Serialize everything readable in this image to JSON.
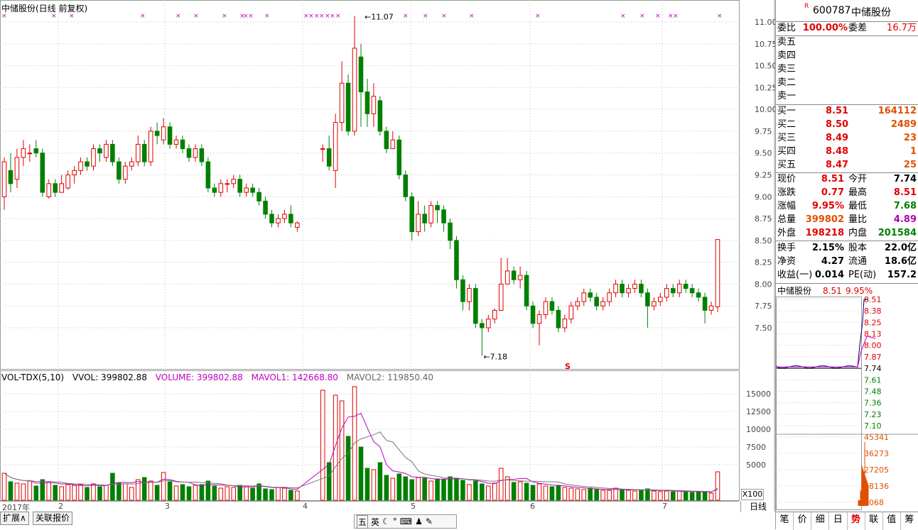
{
  "main_title": "中储股份(日线 前复权)",
  "high_annot": "11.07",
  "low_annot": "7.18",
  "s_mark": "S",
  "vol_legend": {
    "label": "VOL-TDX(5,10)",
    "vvol": "VVOL: 399802.88",
    "volume": "VOLUME: 399802.88",
    "mavol1": "MAVOL1: 142668.80",
    "mavol2": "MAVOL2: 119850.40"
  },
  "price_axis": [
    "11.00",
    "10.75",
    "10.50",
    "10.25",
    "10.00",
    "9.75",
    "9.50",
    "9.25",
    "9.00",
    "8.75",
    "8.50",
    "8.25",
    "8.00",
    "7.75",
    "7.50"
  ],
  "vol_axis": [
    "15000",
    "12500",
    "10000",
    "7500",
    "5000"
  ],
  "x100": "X100",
  "month_labels": [
    "2017年",
    "2",
    "3",
    "4",
    "5",
    "6",
    "7"
  ],
  "day_button": "日线",
  "bottom_tabs": [
    "扩展∧",
    "关联报价"
  ],
  "ime": [
    "五",
    "英",
    "☾",
    "°",
    "⌨",
    "♟",
    "✎"
  ],
  "colors": {
    "up": "#e00000",
    "down": "#008000",
    "grid": "#c0c0c0"
  },
  "quote": {
    "code": "600787",
    "name": "中储股份",
    "weibi_label": "委比",
    "weibi": "100.00%",
    "weicha_label": "委差",
    "weicha": "16.7万",
    "sells": [
      "卖五",
      "卖四",
      "卖三",
      "卖二",
      "卖一"
    ],
    "buys": [
      {
        "label": "买一",
        "price": "8.51",
        "vol": "164112"
      },
      {
        "label": "买二",
        "price": "8.50",
        "vol": "2489"
      },
      {
        "label": "买三",
        "price": "8.49",
        "vol": "23"
      },
      {
        "label": "买四",
        "price": "8.48",
        "vol": "1"
      },
      {
        "label": "买五",
        "price": "8.47",
        "vol": "25"
      }
    ],
    "stats1": [
      {
        "l": "现价",
        "v": "8.51",
        "l2": "今开",
        "v2": "7.74"
      },
      {
        "l": "涨跌",
        "v": "0.77",
        "l2": "最高",
        "v2": "8.51"
      },
      {
        "l": "涨幅",
        "v": "9.95%",
        "l2": "最低",
        "v2": "7.68"
      },
      {
        "l": "总量",
        "v": "399802",
        "l2": "量比",
        "v2": "4.89"
      },
      {
        "l": "外盘",
        "v": "198218",
        "l2": "内盘",
        "v2": "201584"
      }
    ],
    "stats2": [
      {
        "l": "换手",
        "v": "2.15%",
        "l2": "股本",
        "v2": "22.0亿"
      },
      {
        "l": "净资",
        "v": "4.27",
        "l2": "流通",
        "v2": "18.6亿"
      },
      {
        "l": "收益(一)",
        "v": "0.014",
        "l2": "PE(动)",
        "v2": "157.2"
      }
    ],
    "intraday_title": "中储股份",
    "intraday_price": "8.51",
    "intraday_pct": "9.95%",
    "intraday_axis": [
      "8.51",
      "8.38",
      "8.25",
      "8.13",
      "8.00",
      "7.87",
      "7.74",
      "7.61",
      "7.48",
      "7.36",
      "7.23",
      "7.10"
    ],
    "intraday_vol_axis": [
      "45341",
      "36273",
      "27205",
      "18136",
      "9068"
    ],
    "tabs": [
      "笔",
      "价",
      "细",
      "日",
      "势",
      "联",
      "值",
      "筹"
    ],
    "active_tab": "势"
  },
  "chart_data": {
    "type": "candlestick",
    "price_range": [
      7.0,
      11.1
    ],
    "vol_range": [
      0,
      16500
    ],
    "candles": [
      [
        9.0,
        9.4,
        9.45,
        8.85,
        3800
      ],
      [
        9.3,
        9.15,
        9.5,
        9.05,
        2600
      ],
      [
        9.2,
        9.45,
        9.55,
        9.1,
        2400
      ],
      [
        9.45,
        9.55,
        9.65,
        9.35,
        2300
      ],
      [
        9.5,
        9.5,
        9.6,
        9.4,
        2700
      ],
      [
        9.55,
        9.5,
        9.65,
        9.45,
        2000
      ],
      [
        9.5,
        9.05,
        9.55,
        9.0,
        2900
      ],
      [
        9.0,
        9.15,
        9.2,
        8.98,
        2500
      ],
      [
        9.15,
        9.05,
        9.2,
        9.0,
        2100
      ],
      [
        9.05,
        9.15,
        9.25,
        9.05,
        1900
      ],
      [
        9.1,
        9.25,
        9.3,
        9.08,
        2200
      ],
      [
        9.25,
        9.3,
        9.35,
        9.15,
        2100
      ],
      [
        9.3,
        9.4,
        9.45,
        9.25,
        2200
      ],
      [
        9.4,
        9.35,
        9.45,
        9.3,
        1800
      ],
      [
        9.35,
        9.55,
        9.6,
        9.3,
        2300
      ],
      [
        9.55,
        9.5,
        9.6,
        9.4,
        1900
      ],
      [
        9.45,
        9.6,
        9.65,
        9.4,
        2100
      ],
      [
        9.6,
        9.4,
        9.65,
        9.35,
        3800
      ],
      [
        9.4,
        9.2,
        9.45,
        9.15,
        2400
      ],
      [
        9.2,
        9.35,
        9.4,
        9.15,
        2300
      ],
      [
        9.35,
        9.4,
        9.45,
        9.3,
        1800
      ],
      [
        9.4,
        9.6,
        9.7,
        9.35,
        2900
      ],
      [
        9.6,
        9.4,
        9.65,
        9.35,
        3200
      ],
      [
        9.4,
        9.75,
        9.8,
        9.35,
        2700
      ],
      [
        9.75,
        9.7,
        9.85,
        9.6,
        2100
      ],
      [
        9.65,
        9.8,
        9.9,
        9.6,
        3900
      ],
      [
        9.8,
        9.6,
        9.85,
        9.55,
        2600
      ],
      [
        9.6,
        9.65,
        9.7,
        9.55,
        2000
      ],
      [
        9.65,
        9.55,
        9.7,
        9.5,
        2200
      ],
      [
        9.55,
        9.45,
        9.6,
        9.4,
        1900
      ],
      [
        9.45,
        9.55,
        9.6,
        9.4,
        2100
      ],
      [
        9.55,
        9.4,
        9.6,
        9.35,
        2200
      ],
      [
        9.4,
        9.1,
        9.45,
        9.05,
        2700
      ],
      [
        9.1,
        9.05,
        9.15,
        9.0,
        2000
      ],
      [
        9.05,
        9.15,
        9.2,
        9.0,
        1700
      ],
      [
        9.15,
        9.15,
        9.2,
        9.05,
        1900
      ],
      [
        9.15,
        9.2,
        9.25,
        9.1,
        1800
      ],
      [
        9.2,
        9.05,
        9.25,
        9.0,
        2100
      ],
      [
        9.05,
        9.1,
        9.15,
        9.0,
        1900
      ],
      [
        9.1,
        9.05,
        9.15,
        9.0,
        1700
      ],
      [
        9.05,
        8.95,
        9.1,
        8.9,
        2300
      ],
      [
        8.95,
        8.8,
        9.0,
        8.75,
        1600
      ],
      [
        8.8,
        8.7,
        8.85,
        8.65,
        1500
      ],
      [
        8.7,
        8.75,
        8.8,
        8.65,
        1800
      ],
      [
        8.75,
        8.8,
        8.85,
        8.7,
        1700
      ],
      [
        8.8,
        8.7,
        8.9,
        8.65,
        1400
      ],
      [
        8.65,
        8.7,
        8.72,
        8.6,
        1300
      ],
      [
        9.55,
        9.55,
        9.6,
        9.4,
        15500
      ],
      [
        9.55,
        9.35,
        9.7,
        9.3,
        5300
      ],
      [
        9.3,
        9.85,
        9.95,
        9.1,
        14800
      ],
      [
        9.85,
        10.3,
        10.55,
        9.75,
        14000
      ],
      [
        10.3,
        9.75,
        10.4,
        9.7,
        9000
      ],
      [
        9.75,
        10.7,
        11.07,
        9.7,
        16000
      ],
      [
        10.6,
        10.2,
        10.75,
        9.8,
        7500
      ],
      [
        10.2,
        9.95,
        10.35,
        9.8,
        4500
      ],
      [
        9.95,
        10.15,
        10.3,
        9.8,
        4300
      ],
      [
        10.1,
        9.75,
        10.15,
        9.7,
        5300
      ],
      [
        9.75,
        9.55,
        9.8,
        9.5,
        3500
      ],
      [
        9.55,
        9.65,
        9.75,
        9.55,
        3100
      ],
      [
        9.65,
        9.25,
        9.7,
        9.2,
        3700
      ],
      [
        9.25,
        9.0,
        9.3,
        8.95,
        3300
      ],
      [
        9.0,
        8.6,
        9.05,
        8.5,
        2900
      ],
      [
        8.6,
        8.8,
        8.95,
        8.55,
        3200
      ],
      [
        8.8,
        8.7,
        8.9,
        8.6,
        3100
      ],
      [
        8.7,
        8.9,
        8.95,
        8.65,
        2700
      ],
      [
        8.9,
        8.85,
        8.95,
        8.7,
        3000
      ],
      [
        8.85,
        8.7,
        8.9,
        8.6,
        2900
      ],
      [
        8.7,
        8.5,
        8.75,
        8.4,
        3300
      ],
      [
        8.5,
        8.05,
        8.55,
        7.95,
        3100
      ],
      [
        8.05,
        7.8,
        8.1,
        7.7,
        2800
      ],
      [
        7.8,
        7.95,
        8.0,
        7.7,
        2200
      ],
      [
        7.95,
        7.55,
        8.0,
        7.5,
        2700
      ],
      [
        7.55,
        7.5,
        7.6,
        7.18,
        2300
      ],
      [
        7.5,
        7.6,
        7.65,
        7.45,
        2000
      ],
      [
        7.6,
        7.7,
        7.72,
        7.55,
        2400
      ],
      [
        7.7,
        8.0,
        8.3,
        7.9,
        4500
      ],
      [
        8.0,
        8.15,
        8.3,
        8.0,
        3300
      ],
      [
        8.15,
        8.05,
        8.2,
        8.0,
        2500
      ],
      [
        8.05,
        8.1,
        8.2,
        7.95,
        2600
      ],
      [
        8.1,
        7.75,
        8.15,
        7.7,
        2400
      ],
      [
        7.75,
        7.55,
        7.8,
        7.5,
        2100
      ],
      [
        7.55,
        7.65,
        7.7,
        7.3,
        2300
      ],
      [
        7.65,
        7.8,
        7.85,
        7.6,
        2000
      ],
      [
        7.8,
        7.7,
        7.85,
        7.65,
        1900
      ],
      [
        7.7,
        7.5,
        7.75,
        7.45,
        2100
      ],
      [
        7.5,
        7.6,
        7.65,
        7.45,
        1800
      ],
      [
        7.6,
        7.75,
        7.8,
        7.55,
        1700
      ],
      [
        7.75,
        7.8,
        7.85,
        7.7,
        1600
      ],
      [
        7.8,
        7.9,
        7.95,
        7.75,
        1500
      ],
      [
        7.9,
        7.85,
        7.95,
        7.8,
        1700
      ],
      [
        7.85,
        7.75,
        7.9,
        7.7,
        1500
      ],
      [
        7.75,
        7.8,
        7.85,
        7.7,
        1400
      ],
      [
        7.8,
        7.9,
        7.95,
        7.75,
        1400
      ],
      [
        7.9,
        8.0,
        8.05,
        7.85,
        1700
      ],
      [
        8.0,
        7.9,
        8.05,
        7.85,
        1500
      ],
      [
        7.9,
        7.95,
        8.0,
        7.85,
        1400
      ],
      [
        7.95,
        8.0,
        8.05,
        7.9,
        1300
      ],
      [
        8.0,
        7.9,
        8.05,
        7.85,
        1400
      ],
      [
        7.9,
        7.75,
        7.95,
        7.5,
        1600
      ],
      [
        7.75,
        7.8,
        7.85,
        7.7,
        1300
      ],
      [
        7.8,
        7.85,
        7.9,
        7.75,
        1200
      ],
      [
        7.85,
        7.95,
        8.0,
        7.8,
        1300
      ],
      [
        7.95,
        7.9,
        8.0,
        7.85,
        1200
      ],
      [
        7.9,
        8.0,
        8.05,
        7.85,
        1300
      ],
      [
        8.0,
        7.95,
        8.05,
        7.9,
        1200
      ],
      [
        7.95,
        7.9,
        8.0,
        7.85,
        1100
      ],
      [
        7.9,
        7.85,
        7.95,
        7.8,
        1200
      ],
      [
        7.85,
        7.7,
        7.9,
        7.55,
        1100
      ],
      [
        7.7,
        7.75,
        7.8,
        7.65,
        1000
      ],
      [
        7.74,
        8.51,
        8.51,
        7.68,
        4000
      ]
    ],
    "gap_after_index": 46
  }
}
